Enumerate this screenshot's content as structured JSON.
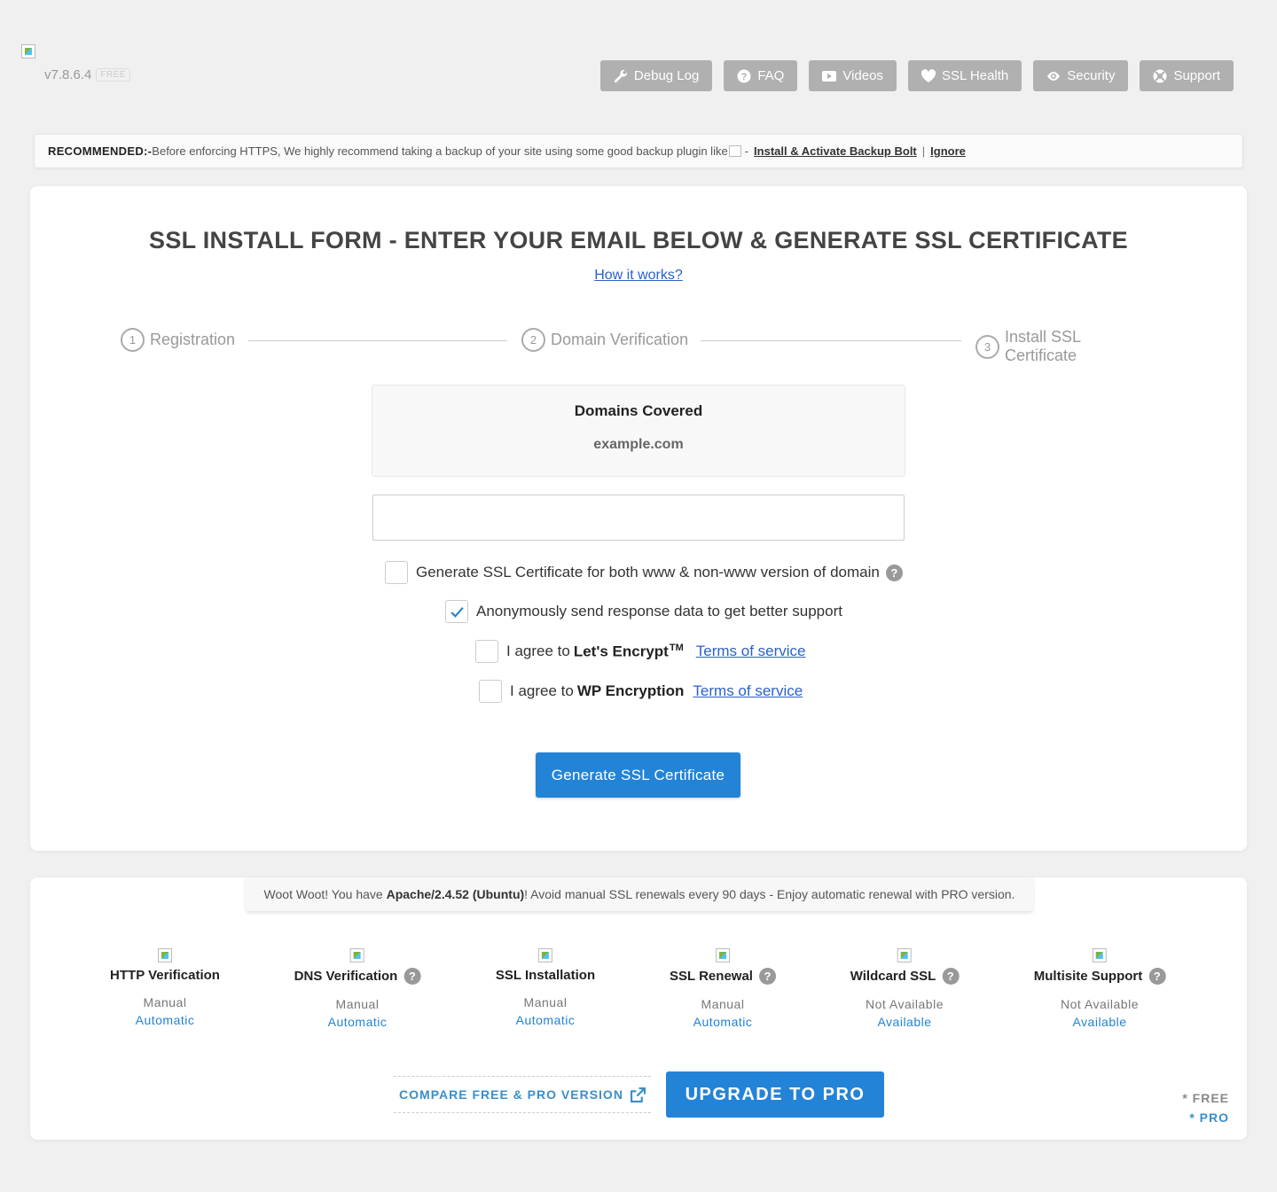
{
  "header": {
    "version": "v7.8.6.4",
    "badge": "FREE",
    "nav": [
      {
        "label": "Debug Log",
        "icon": "wrench-icon"
      },
      {
        "label": "FAQ",
        "icon": "question-icon"
      },
      {
        "label": "Videos",
        "icon": "play-icon"
      },
      {
        "label": "SSL Health",
        "icon": "heart-icon"
      },
      {
        "label": "Security",
        "icon": "eye-icon"
      },
      {
        "label": "Support",
        "icon": "lifebuoy-icon"
      }
    ]
  },
  "recommend": {
    "label": "RECOMMENDED:-",
    "text": "Before enforcing HTTPS, We highly recommend taking a backup of your site using some good backup plugin like",
    "img_alt": "-",
    "install_link": "Install & Activate Backup Bolt",
    "separator": "|",
    "ignore_link": "Ignore"
  },
  "form": {
    "title": "SSL INSTALL FORM - ENTER YOUR EMAIL BELOW & GENERATE SSL CERTIFICATE",
    "how_link": "How it works?",
    "steps": [
      {
        "num": "1",
        "label": "Registration"
      },
      {
        "num": "2",
        "label": "Domain Verification"
      },
      {
        "num": "3",
        "label": "Install SSL Certificate"
      }
    ],
    "domains_title": "Domains Covered",
    "domain": "example.com",
    "email_value": "",
    "opt_www": "Generate SSL Certificate for both www & non-www version of domain",
    "opt_anon": "Anonymously send response data to get better support",
    "opt_le_prefix": "I agree to",
    "opt_le_name": "Let's Encrypt",
    "opt_le_tm": "TM",
    "opt_wpe_prefix": "I agree to",
    "opt_wpe_name": "WP Encryption",
    "tos": "Terms of service",
    "qmark": "?",
    "generate_button": "Generate SSL Certificate"
  },
  "pro": {
    "woot_prefix": "Woot Woot! You have ",
    "woot_server": "Apache/2.4.52 (Ubuntu)",
    "woot_suffix": "! Avoid manual SSL renewals every 90 days - Enjoy automatic renewal with PRO version.",
    "features": [
      {
        "name": "HTTP Verification",
        "free": "Manual",
        "pro": "Automatic",
        "help": false
      },
      {
        "name": "DNS Verification",
        "free": "Manual",
        "pro": "Automatic",
        "help": true
      },
      {
        "name": "SSL Installation",
        "free": "Manual",
        "pro": "Automatic",
        "help": false
      },
      {
        "name": "SSL Renewal",
        "free": "Manual",
        "pro": "Automatic",
        "help": true
      },
      {
        "name": "Wildcard SSL",
        "free": "Not Available",
        "pro": "Available",
        "help": true
      },
      {
        "name": "Multisite Support",
        "free": "Not Available",
        "pro": "Available",
        "help": true
      }
    ],
    "compare": "COMPARE FREE & PRO VERSION",
    "upgrade": "UPGRADE TO PRO",
    "legend_free": "* FREE",
    "legend_pro": "* PRO"
  },
  "colors": {
    "accent": "#2383d6",
    "nav_button": "#b0b0b0",
    "link": "#2a62c9"
  }
}
